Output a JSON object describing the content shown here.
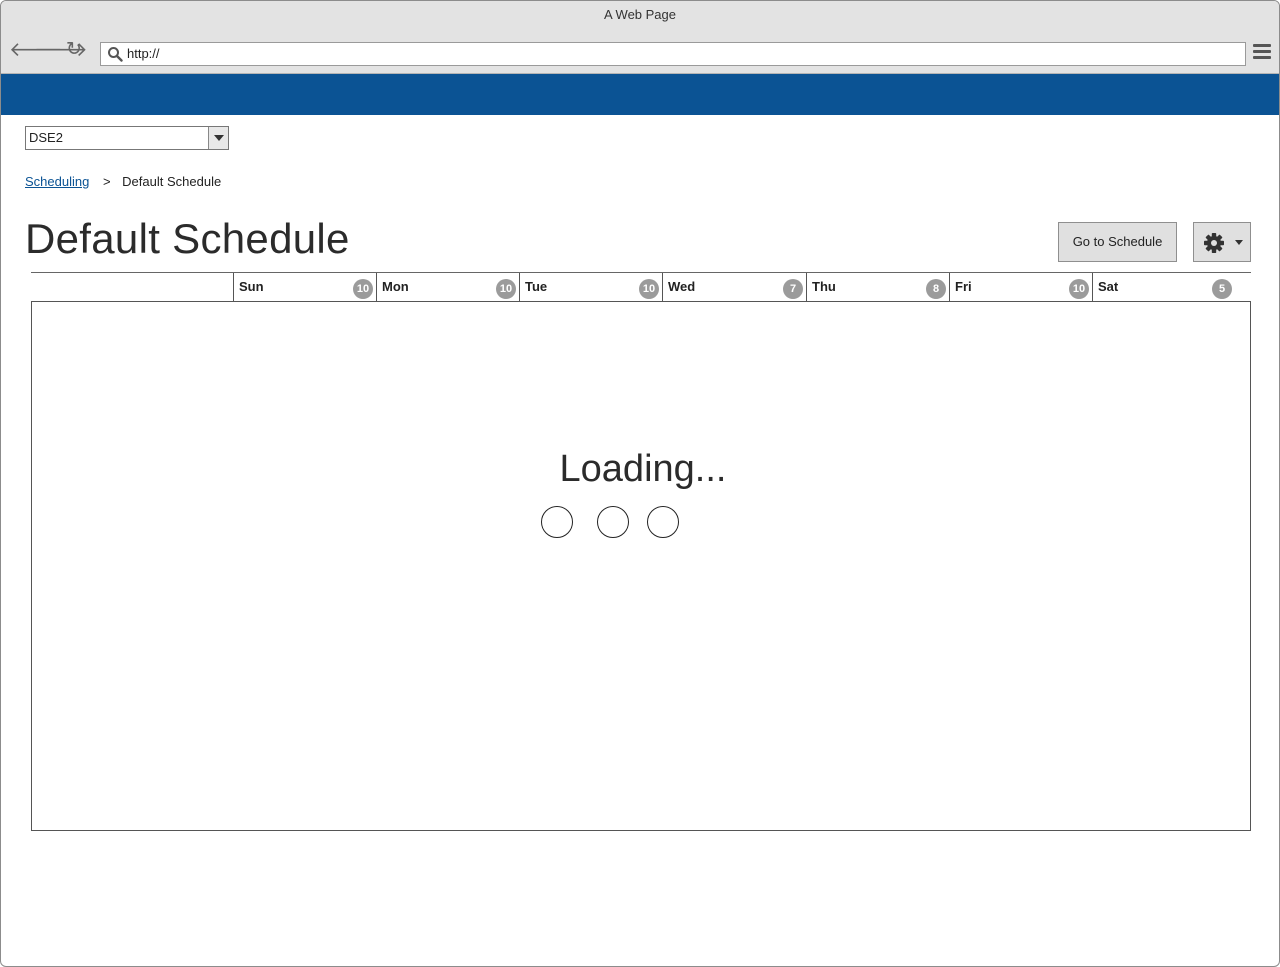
{
  "browser": {
    "window_title": "A Web Page",
    "url": "http://"
  },
  "colors": {
    "banner": "#0b5394",
    "link": "#0b5394",
    "count_badge": "#9b9b9b"
  },
  "location_select": {
    "selected": "DSE2"
  },
  "breadcrumb": {
    "parent": "Scheduling",
    "separator": ">",
    "current": "Default Schedule"
  },
  "page": {
    "title": "Default Schedule",
    "goto_button": "Go to Schedule"
  },
  "days": [
    {
      "name": "Sun",
      "count": "10"
    },
    {
      "name": "Mon",
      "count": "10"
    },
    {
      "name": "Tue",
      "count": "10"
    },
    {
      "name": "Wed",
      "count": "7"
    },
    {
      "name": "Thu",
      "count": "8"
    },
    {
      "name": "Fri",
      "count": "10"
    },
    {
      "name": "Sat",
      "count": "5"
    }
  ],
  "loading": {
    "text": "Loading..."
  },
  "icons": {
    "back": "arrow-left-icon",
    "forward": "arrow-right-icon",
    "reload": "reload-icon",
    "search": "search-icon",
    "menu": "hamburger-menu-icon",
    "settings": "gear-icon",
    "dropdown": "chevron-down-icon"
  }
}
